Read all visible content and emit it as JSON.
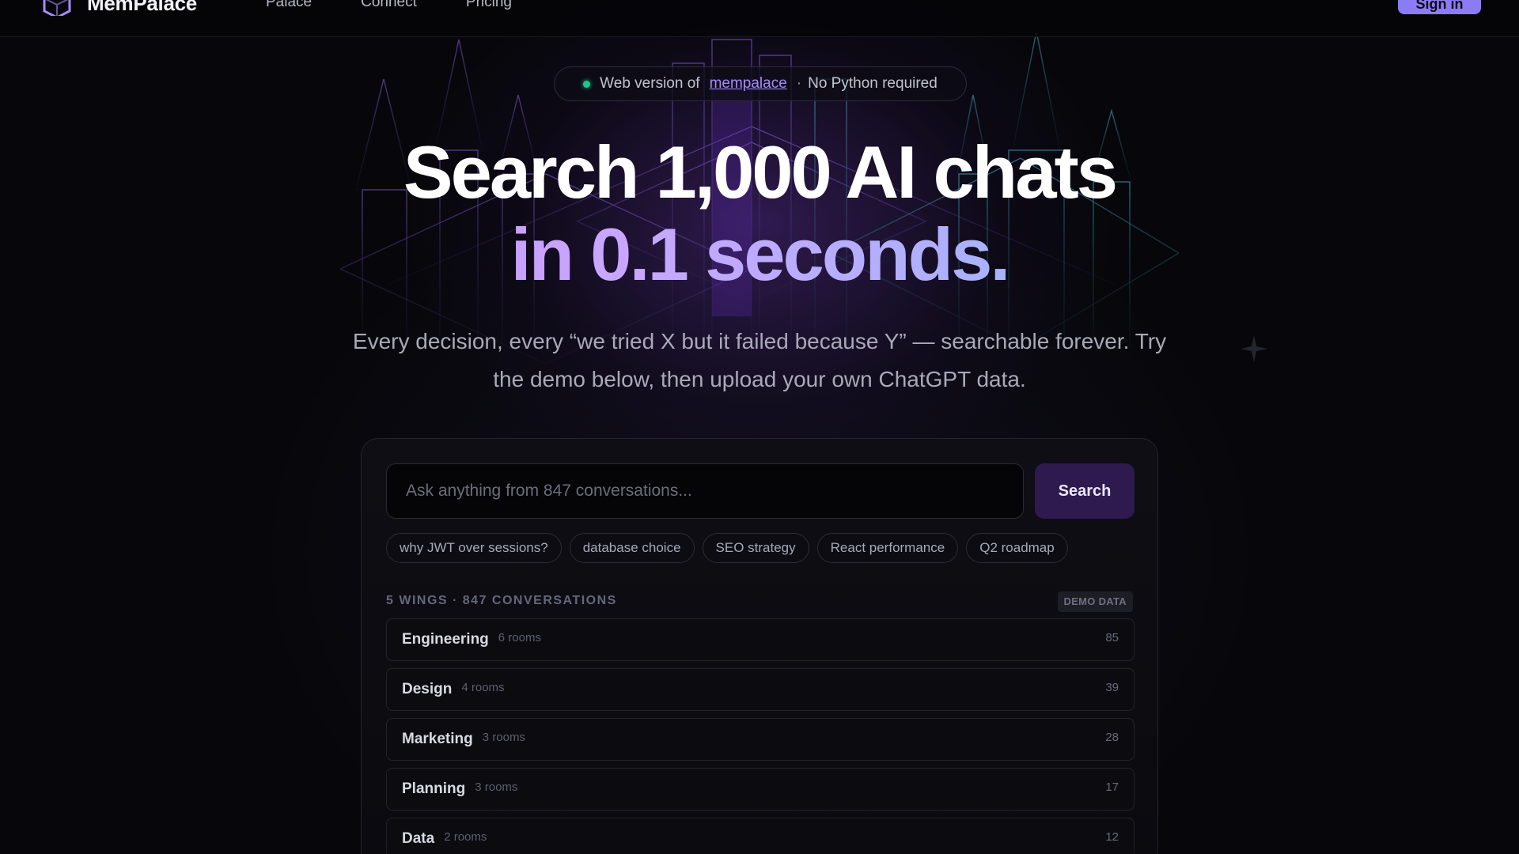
{
  "nav": {
    "brand": "MemPalace",
    "links": [
      "Palace",
      "Connect",
      "Pricing"
    ],
    "signin_label": "Sign in"
  },
  "hero": {
    "pill": {
      "prefix": "Web version of",
      "link": "mempalace",
      "suffix": "No Python required",
      "separator": "·"
    },
    "title_line1": "Search 1,000 AI chats",
    "title_line2": "in 0.1 seconds.",
    "subtitle": "Every decision, every “we tried X but it failed because Y” — searchable forever. Try the demo below, then upload your own ChatGPT data."
  },
  "search": {
    "placeholder": "Ask anything from 847 conversations...",
    "value": "",
    "button_label": "Search",
    "suggestions": [
      "why JWT over sessions?",
      "database choice",
      "SEO strategy",
      "React performance",
      "Q2 roadmap"
    ]
  },
  "wings": {
    "header": "5 WINGS · 847 CONVERSATIONS",
    "badge": "DEMO DATA",
    "items": [
      {
        "name": "Engineering",
        "rooms": "6 rooms",
        "count": "85"
      },
      {
        "name": "Design",
        "rooms": "4 rooms",
        "count": "39"
      },
      {
        "name": "Marketing",
        "rooms": "3 rooms",
        "count": "28"
      },
      {
        "name": "Planning",
        "rooms": "3 rooms",
        "count": "17"
      },
      {
        "name": "Data",
        "rooms": "2 rooms",
        "count": "12"
      }
    ]
  },
  "colors": {
    "accent": "#8b7cf6",
    "status_dot": "#22c58b",
    "search_button": "#2e1a4f",
    "gradient_start": "#c084fc",
    "gradient_end": "#5ee2f2"
  },
  "icons": {
    "logo": "cube-logo-icon",
    "status": "green-dot-icon",
    "decoration": "sparkle-icon"
  }
}
